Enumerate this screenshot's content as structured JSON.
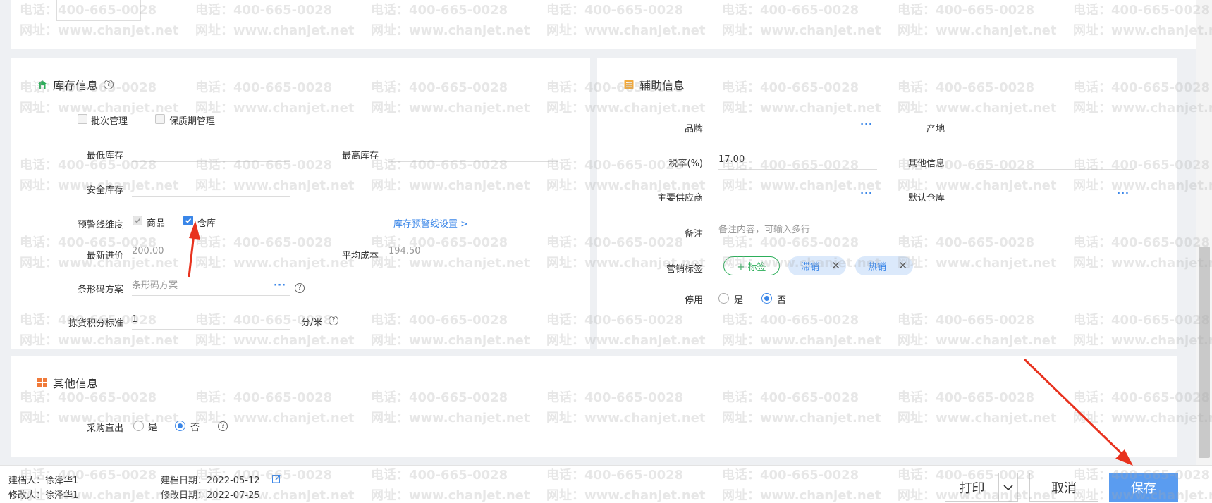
{
  "watermark": {
    "phone": "电话：400-665-0028",
    "site": "网址：www.chanjet.net"
  },
  "inventory": {
    "title": "库存信息",
    "batch_label": "批次管理",
    "shelf_label": "保质期管理",
    "min_stock_label": "最低库存",
    "max_stock_label": "最高库存",
    "safe_stock_label": "安全库存",
    "warn_dim_label": "预警线维度",
    "warn_goods_label": "商品",
    "warn_warehouse_label": "仓库",
    "warn_link": "库存预警线设置 >",
    "latest_price_label": "最新进价",
    "latest_price_value": "200.00",
    "avg_cost_label": "平均成本",
    "avg_cost_value": "194.50",
    "barcode_label": "条形码方案",
    "barcode_placeholder": "条形码方案",
    "pick_label": "拣货积分标准",
    "pick_value": "1",
    "pick_unit": "分/米"
  },
  "aux": {
    "title": "辅助信息",
    "brand_label": "品牌",
    "origin_label": "产地",
    "tax_label": "税率(%)",
    "tax_value": "17.00",
    "other_label": "其他信息",
    "supplier_label": "主要供应商",
    "warehouse_label": "默认仓库",
    "note_label": "备注",
    "note_placeholder": "备注内容，可输入多行",
    "tags_label": "营销标签",
    "add_tag_label": "+ 标签",
    "tags": [
      "滞销",
      "热销"
    ],
    "disable_label": "停用",
    "yes": "是",
    "no": "否"
  },
  "other": {
    "title": "其他信息",
    "direct_label": "采购直出",
    "yes": "是",
    "no": "否"
  },
  "footer": {
    "creator": "建档人：徐泽华1",
    "modifier": "修改人：徐泽华1",
    "create_date": "建档日期：2022-05-12",
    "modify_date": "修改日期：2022-07-25",
    "print": "打印",
    "cancel": "取消",
    "save": "保存"
  },
  "colors": {
    "accent": "#3a86e8",
    "primary_button": "#5a9cf0",
    "annotation": "#e8321e"
  }
}
